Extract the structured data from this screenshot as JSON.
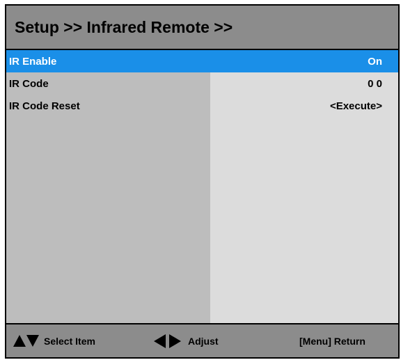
{
  "header": {
    "title": "Setup >> Infrared Remote >>"
  },
  "menu": {
    "items": [
      {
        "label": "IR Enable",
        "value": "On",
        "selected": true
      },
      {
        "label": "IR Code",
        "value": "0 0",
        "selected": false
      },
      {
        "label": "IR Code Reset",
        "value": "<Execute>",
        "selected": false
      }
    ]
  },
  "footer": {
    "select_label": "Select Item",
    "adjust_label": "Adjust",
    "return_label": "[Menu] Return",
    "icons": {
      "select": "up-down-arrows-icon",
      "adjust": "left-right-arrows-icon"
    }
  },
  "colors": {
    "header_bg": "#8c8c8c",
    "selected_bg": "#1a8fe8",
    "label_column_bg": "#bdbdbd",
    "value_column_bg": "#dcdcdc"
  }
}
